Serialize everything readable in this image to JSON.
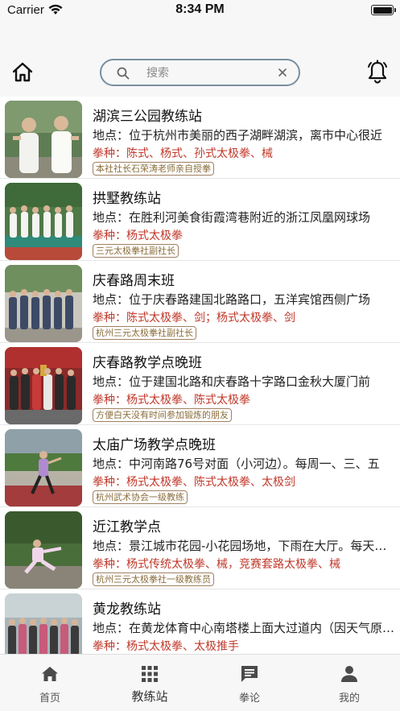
{
  "status_bar": {
    "carrier": "Carrier",
    "time": "8:34 PM"
  },
  "header": {
    "home_icon": "home-icon",
    "search": {
      "placeholder": "搜索",
      "value": ""
    },
    "bell_icon": "bell-icon"
  },
  "stations": [
    {
      "title": "湖滨三公园教练站",
      "address": "地点：位于杭州市美丽的西子湖畔湖滨，离市中心很近",
      "styles": "拳种：陈式、杨式、孙式太极拳、械",
      "tag": "本社社长石荣涛老师亲自授拳"
    },
    {
      "title": "拱墅教练站",
      "address": "地点：在胜利河美食街霞湾巷附近的浙江凤凰网球场",
      "styles": "拳种：杨式太极拳",
      "tag": "三元太极拳社副社长"
    },
    {
      "title": "庆春路周末班",
      "address": "地点：位于庆春路建国北路路口，五洋宾馆西侧广场",
      "styles": "拳种：陈式太极拳、剑；杨式太极拳、剑",
      "tag": "杭州三元太极拳社副社长"
    },
    {
      "title": "庆春路教学点晚班",
      "address": "地点：位于建国北路和庆春路十字路口金秋大厦门前",
      "styles": "拳种：杨式太极拳、陈式太极拳",
      "tag": "方便白天没有时间参加锻炼的朋友"
    },
    {
      "title": "太庙广场教学点晚班",
      "address": "地点：中河南路76号对面（小河边）。每周一、三、五",
      "styles": "拳种：杨式太极拳、陈式太极拳、太极剑",
      "tag": "杭州武术协会一级教练"
    },
    {
      "title": "近江教学点",
      "address": "地点：景江城市花园-小花园场地，下雨在大厅。每天早上",
      "styles": "拳种：杨式传统太极拳、械，竞赛套路太极拳、械",
      "tag": "杭州三元太极拳社一级教练员"
    },
    {
      "title": "黄龙教练站",
      "address": "地点：在黄龙体育中心南塔楼上面大过道内（因天气原因）",
      "styles": "拳种：杨式太极拳、太极推手",
      "tag": ""
    }
  ],
  "tabs": [
    {
      "label": "首页",
      "icon": "home-icon"
    },
    {
      "label": "教练站",
      "icon": "grid-icon"
    },
    {
      "label": "拳论",
      "icon": "message-icon"
    },
    {
      "label": "我的",
      "icon": "user-icon"
    }
  ],
  "active_tab": "教练站",
  "colors": {
    "style_text": "#c0392b",
    "tag_border": "#a08060",
    "search_border": "#7a8fa0"
  }
}
